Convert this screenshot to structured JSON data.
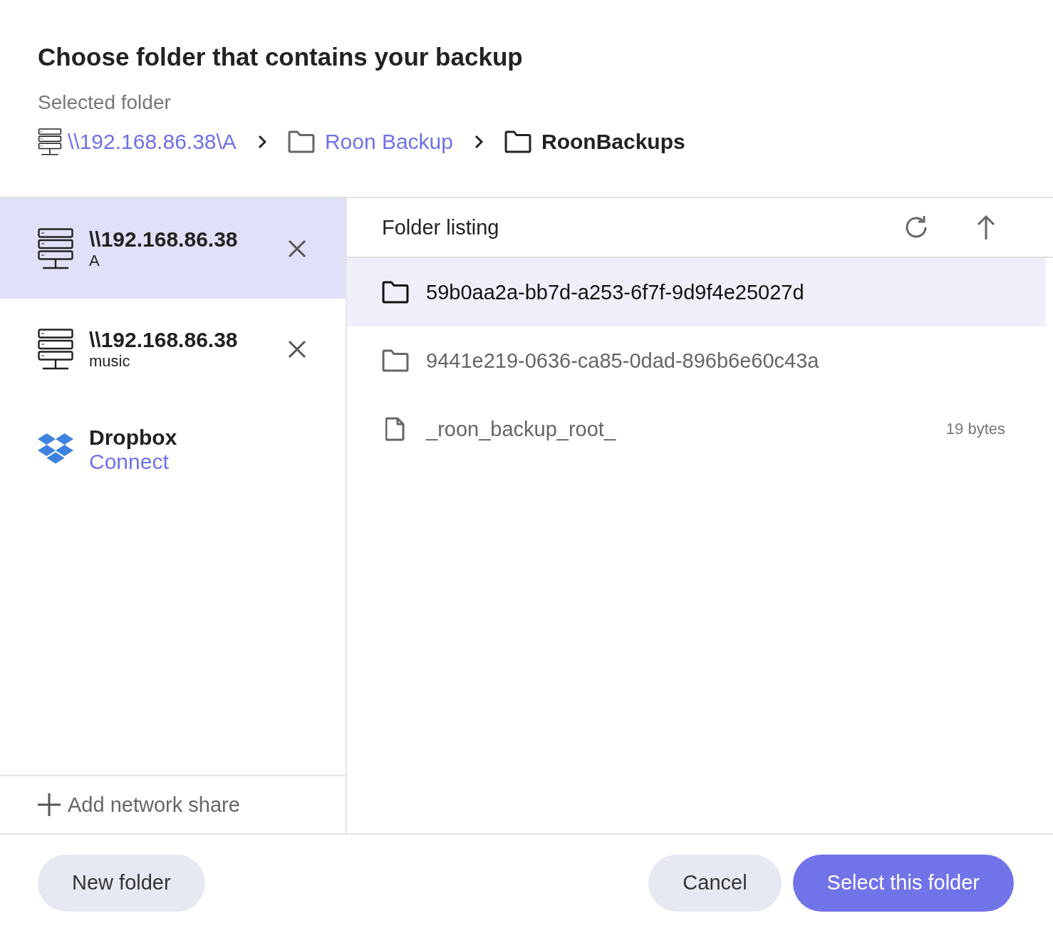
{
  "dialog": {
    "title": "Choose folder that contains your backup"
  },
  "selected_folder": {
    "label": "Selected folder",
    "path": [
      {
        "kind": "server",
        "name": "\\\\192.168.86.38\\A",
        "current": false
      },
      {
        "kind": "folder",
        "name": "Roon Backup",
        "current": false
      },
      {
        "kind": "folder",
        "name": "RoonBackups",
        "current": true
      }
    ]
  },
  "sources": [
    {
      "kind": "share",
      "title": "\\\\192.168.86.38",
      "subtitle": "A",
      "selected": true
    },
    {
      "kind": "share",
      "title": "\\\\192.168.86.38",
      "subtitle": "music",
      "selected": false
    },
    {
      "kind": "cloud",
      "title": "Dropbox",
      "action": "Connect",
      "selected": false
    }
  ],
  "add_share": {
    "label": "Add network share"
  },
  "listing": {
    "title": "Folder listing",
    "items": [
      {
        "kind": "folder",
        "name": "59b0aa2a-bb7d-a253-6f7f-9d9f4e25027d",
        "selected": true
      },
      {
        "kind": "folder",
        "name": "9441e219-0636-ca85-0dad-896b6e60c43a",
        "selected": false
      },
      {
        "kind": "file",
        "name": "_roon_backup_root_",
        "size": "19 bytes",
        "selected": false
      }
    ]
  },
  "buttons": {
    "left": [
      "New folder"
    ],
    "right": [
      {
        "label": "Cancel",
        "primary": false
      },
      {
        "label": "Select this folder",
        "primary": true
      }
    ]
  }
}
